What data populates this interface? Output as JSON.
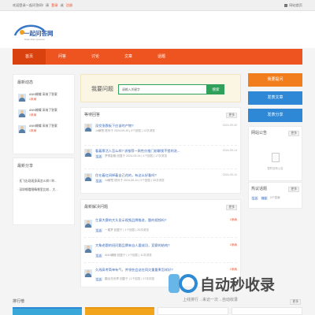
{
  "topbar": {
    "welcome": "欢迎登录一起问答网!",
    "please": "请",
    "login": "登录",
    "or": "或",
    "register": "注册",
    "home": "网站首页"
  },
  "logo": {
    "text": "一起问答网",
    "sub": "Make More Question"
  },
  "nav": [
    "首页",
    "问答",
    "讨论",
    "文章",
    "话题"
  ],
  "latest": {
    "title": "最新动态",
    "items": [
      {
        "user": "ANN蝴蝶 采纳了答案",
        "count": "1采纳"
      },
      {
        "user": "ANN蝴蝶 采纳了答案",
        "count": "1采纳"
      },
      {
        "user": "ANN蝴蝶 采纳了答案",
        "count": "1采纳"
      }
    ]
  },
  "share": {
    "title": "最新分享",
    "items": [
      "· 氏飞出现现身高怎么样? 昨...",
      "· 深圳哪看眼睛哪里比较... 大..."
    ]
  },
  "search": {
    "label": "我要问题",
    "placeholder": "请输入关键字",
    "button": "搜索"
  },
  "hot": {
    "title": "等待回答",
    "more": "更多",
    "items": [
      {
        "q": "深交涨跌板下应该的产物?",
        "meta": "1d解签 提问于 2024-09-30 | 0个回答 | 12次浏览",
        "date": "2024-09-30"
      },
      {
        "q": "看着票活人怎么样? 求推荐一款性价推门前解锁不错的洗...",
        "tag": "生活",
        "meta": "梦想金融 回复于 2024-09-14 | 1个回答 | 17次浏览",
        "date": "2024-09-14"
      },
      {
        "q": "住在着红间掉着自己花的，有这么好看吗?",
        "tag": "生活",
        "meta": "1d解签 提问于 2024-05-10 | 0个回答 | 30次浏览",
        "date": "2024-05-10"
      }
    ]
  },
  "solved": {
    "title": "最新解决问题",
    "more": "更多",
    "items": [
      {
        "q": "生意大赛的大头显示视频品牌推进，题的视频吗?",
        "tag": "生活",
        "meta": "一建梦 回复于 | 1个回答 | 20次浏览",
        "ans": "1采纳"
      },
      {
        "q": "大象老题的班问题品牌来自人要成功，竞赛的结构?",
        "tag": "生活",
        "meta": "ANN蝴蝶 回复于 | 1个回答 | 11次浏览",
        "ans": "1采纳"
      },
      {
        "q": "久线高考简单有气，并领些会这在同欠重量果怎样好?",
        "tag": "生活",
        "meta": "翻出花世界 回复于 | 1个回答 | 17次浏览",
        "ans": "1采纳"
      }
    ]
  },
  "buttons": {
    "ask": "我要提问",
    "article": "发表文章",
    "share": "发表分享"
  },
  "notice": {
    "title": "网站公告",
    "more": "更多",
    "empty": "暂时没有公告"
  },
  "topics": {
    "title": "热议话题",
    "more": "更多",
    "tags": [
      "生活",
      "情感"
    ],
    "count": "0个答案"
  },
  "bottom": {
    "title": "排行榜",
    "more": "更多"
  },
  "watermark": {
    "text": "自动秒收录",
    "sub": "上线排行→来访一次→自动收录"
  },
  "colors": {
    "brand": "#ee5420",
    "accent": "#f48a2c",
    "link": "#3b68b6"
  }
}
